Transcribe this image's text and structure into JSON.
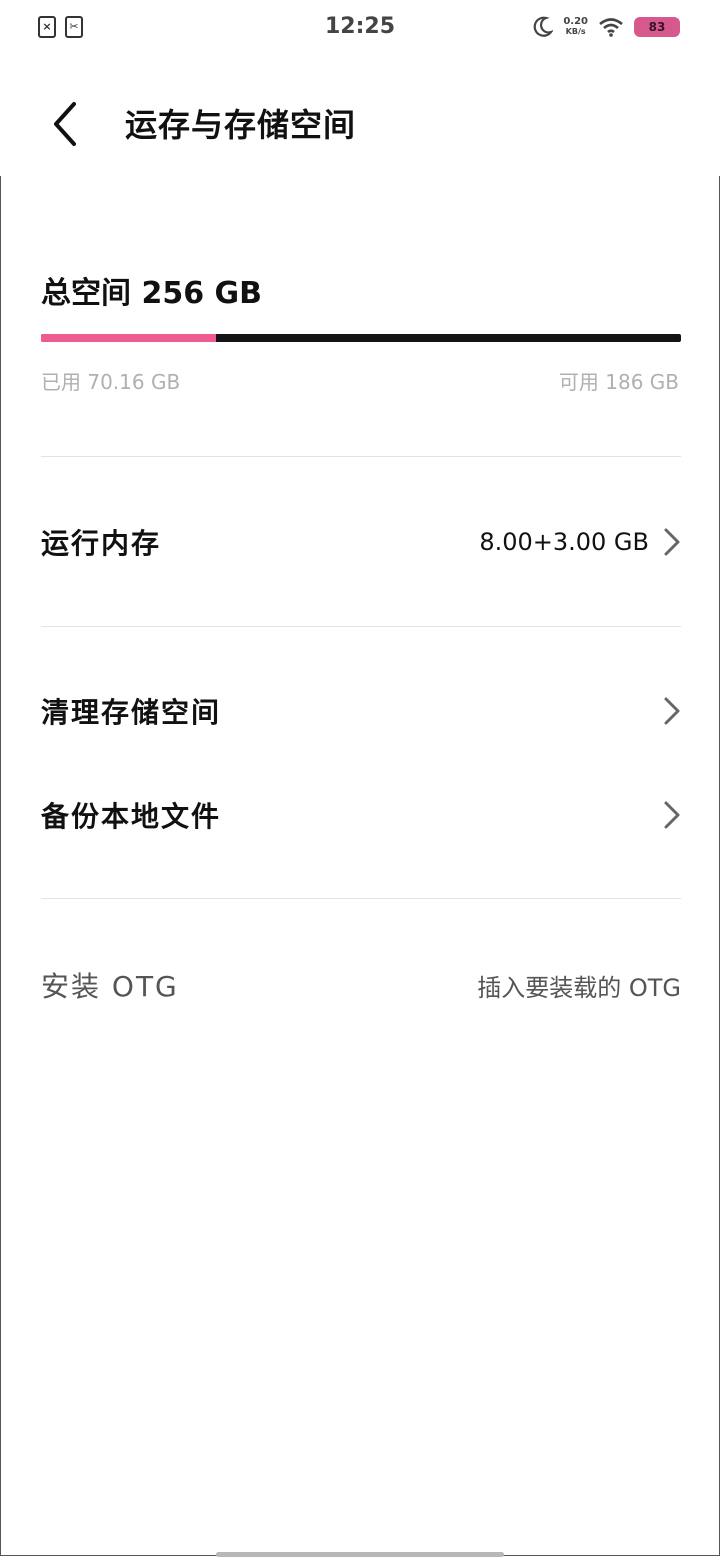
{
  "status_bar": {
    "time": "12:25",
    "speed_value": "0.20",
    "speed_unit": "KB/s",
    "battery": "83",
    "icons": [
      "sim-off-icon",
      "scissors-app-icon",
      "moon-icon",
      "wifi-icon",
      "battery-icon"
    ],
    "battery_color": "#d6588c"
  },
  "header": {
    "title": "运存与存储空间",
    "back_icon": "chevron-left-icon"
  },
  "storage": {
    "total_label": "总空间 256 GB",
    "used_label": "已用 70.16 GB",
    "available_label": "可用 186 GB",
    "used_fraction": 0.274,
    "used_color": "#ef5a93",
    "bar_color": "#141414"
  },
  "rows": {
    "ram": {
      "label": "运行内存",
      "value": "8.00+3.00 GB"
    },
    "clean": {
      "label": "清理存储空间"
    },
    "backup": {
      "label": "备份本地文件"
    },
    "otg": {
      "label": "安装 OTG",
      "value": "插入要装载的 OTG"
    }
  }
}
